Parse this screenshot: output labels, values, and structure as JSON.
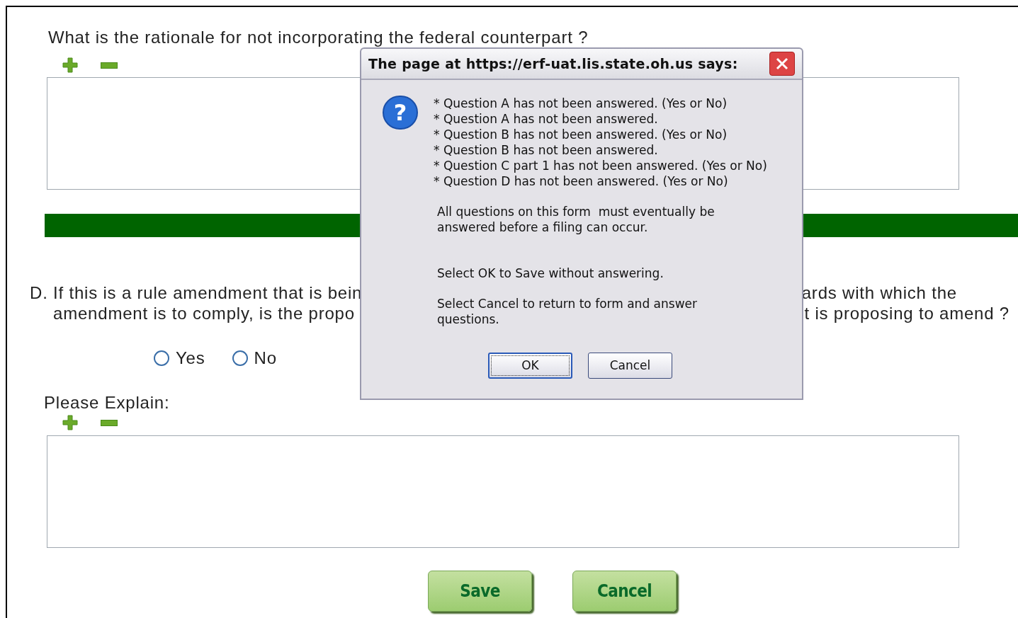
{
  "rationale_question": {
    "label": "What is the rationale for not incorporating the federal counterpart ?"
  },
  "question_d": {
    "line_1_left": "D. If this is a rule amendment that is bein",
    "line_1_right": "ards with which the",
    "line_2_left": "amendment is to comply, is the propo",
    "line_2_right": "t is proposing to amend ?",
    "options": [
      {
        "label": "Yes",
        "selected": false
      },
      {
        "label": "No",
        "selected": false
      }
    ]
  },
  "explain": {
    "label": "Please Explain:"
  },
  "buttons": [
    "Save",
    "Cancel"
  ],
  "dialog": {
    "title": "The page at https://erf-uat.lis.state.oh.us says:",
    "icon_glyph": "?",
    "messages": [
      "* Question A has not been answered. (Yes or No)",
      "* Question A has not been answered.",
      "* Question B has not been answered. (Yes or No)",
      "* Question B has not been answered.",
      "* Question C part 1 has not been answered. (Yes or No)",
      "* Question D has not been answered. (Yes or No)"
    ],
    "paragraphs": [
      [
        "All questions on this form  must eventually be",
        "answered before a filing can occur."
      ],
      [
        "Select OK to Save without answering."
      ],
      [
        "Select Cancel to return to form and answer",
        "questions."
      ]
    ],
    "buttons": [
      {
        "label": "OK",
        "focused": true
      },
      {
        "label": "Cancel",
        "focused": false
      }
    ]
  }
}
